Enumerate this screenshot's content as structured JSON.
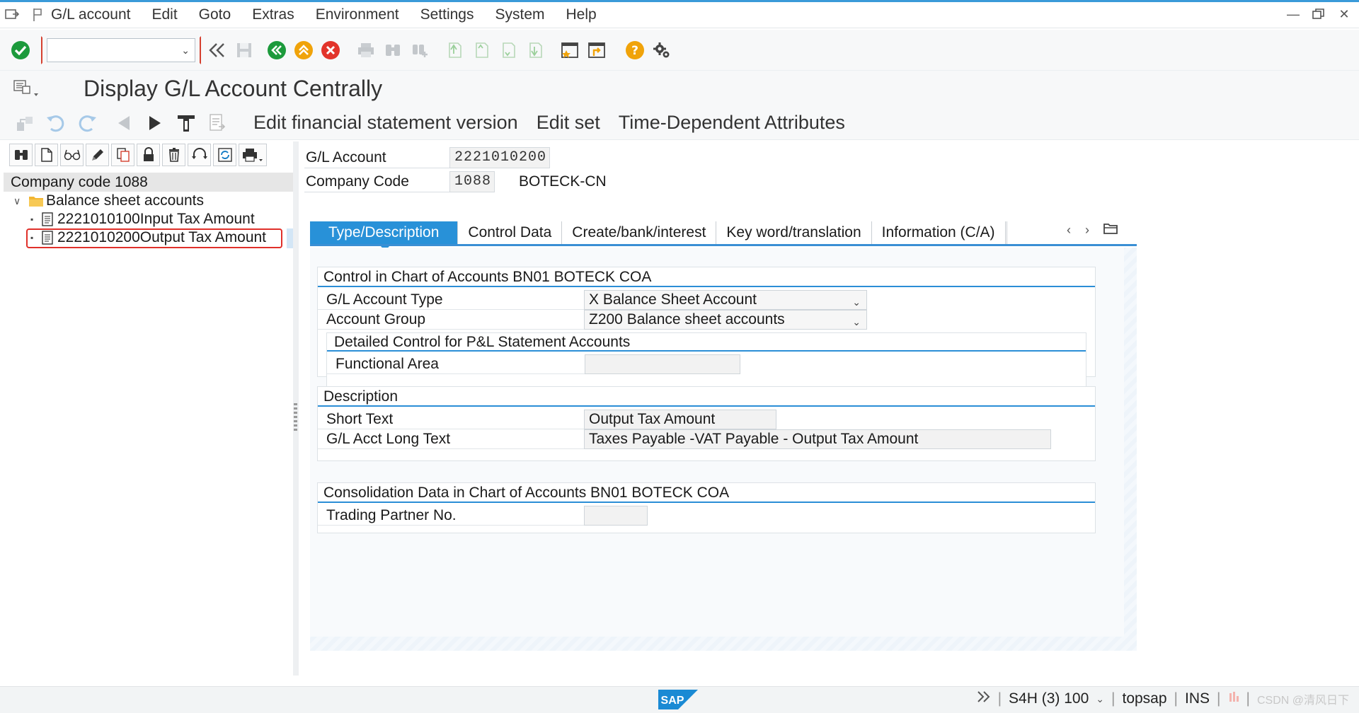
{
  "menubar": {
    "items": [
      "G/L account",
      "Edit",
      "Goto",
      "Extras",
      "Environment",
      "Settings",
      "System",
      "Help"
    ]
  },
  "toolbar": {
    "command_value": ""
  },
  "title": {
    "text": "Display G/L Account Centrally"
  },
  "app_toolbar": {
    "buttons": [
      "Edit financial statement version",
      "Edit set",
      "Time-Dependent Attributes"
    ]
  },
  "left_pane": {
    "header": "Company code 1088",
    "folder": "Balance sheet accounts",
    "items": [
      {
        "label": "2221010100Input Tax Amount"
      },
      {
        "label": "2221010200Output Tax Amount"
      }
    ]
  },
  "header_fields": {
    "gl_account_label": "G/L Account",
    "gl_account_value": "2221010200",
    "company_code_label": "Company Code",
    "company_code_value": "1088",
    "company_name": "BOTECK-CN"
  },
  "tabs": [
    "Type/Description",
    "Control Data",
    "Create/bank/interest",
    "Key word/translation",
    "Information (C/A)"
  ],
  "control_group": {
    "title": "Control in Chart of Accounts BN01 BOTECK COA",
    "account_type_label": "G/L Account Type",
    "account_type_value": "X Balance Sheet Account",
    "account_group_label": "Account Group",
    "account_group_value": "Z200 Balance sheet accounts",
    "pl_title": "Detailed Control for P&L Statement Accounts",
    "functional_area_label": "Functional Area",
    "functional_area_value": ""
  },
  "description_group": {
    "title": "Description",
    "short_text_label": "Short Text",
    "short_text_value": "Output Tax Amount",
    "long_text_label": "G/L Acct Long Text",
    "long_text_value": "Taxes Payable -VAT Payable - Output Tax Amount"
  },
  "consolidation_group": {
    "title": "Consolidation Data in Chart of Accounts BN01 BOTECK COA",
    "trading_partner_label": "Trading Partner No.",
    "trading_partner_value": ""
  },
  "statusbar": {
    "system": "S4H (3) 100",
    "host": "topsap",
    "mode": "INS",
    "watermark": "CSDN @清风日下"
  },
  "colors": {
    "accent": "#2891d8",
    "ok_green": "#1c9a3c",
    "exit_orange": "#f0a30a",
    "cancel_red": "#e2342b",
    "highlight_red": "#e0302a"
  }
}
